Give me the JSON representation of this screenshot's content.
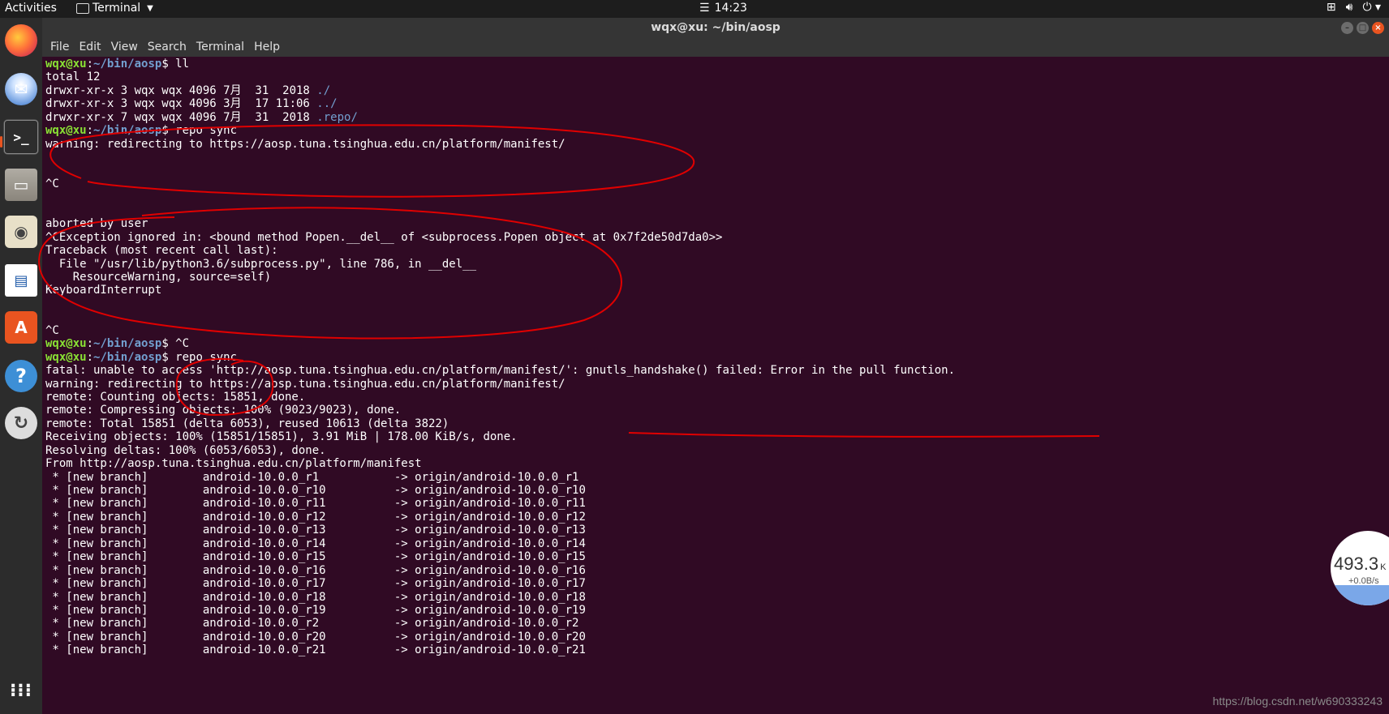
{
  "topbar": {
    "activities": "Activities",
    "app_name": "Terminal",
    "clock_icon": "list-icon",
    "clock": "14:23",
    "tray_icons": [
      "network-icon",
      "volume-icon",
      "power-icon"
    ]
  },
  "dock": {
    "items": [
      "firefox-icon",
      "thunderbird-icon",
      "terminal-icon",
      "files-icon",
      "rhythmbox-icon",
      "writer-icon",
      "software-center-icon",
      "help-icon",
      "software-updater-icon",
      "show-apps-icon"
    ]
  },
  "window": {
    "title": "wqx@xu: ~/bin/aosp",
    "menu": [
      "File",
      "Edit",
      "View",
      "Search",
      "Terminal",
      "Help"
    ]
  },
  "terminal": {
    "prompt_user": "wqx@xu",
    "prompt_path": "~/bin/aosp",
    "lines": [
      {
        "type": "prompt",
        "cmd": " ll"
      },
      {
        "type": "text",
        "text": "total 12"
      },
      {
        "type": "ls",
        "text": "drwxr-xr-x 3 wqx wqx 4096 7月  31  2018 ",
        "name": "./"
      },
      {
        "type": "ls",
        "text": "drwxr-xr-x 3 wqx wqx 4096 3月  17 11:06 ",
        "name": "../"
      },
      {
        "type": "ls",
        "text": "drwxr-xr-x 7 wqx wqx 4096 7月  31  2018 ",
        "name": ".repo/"
      },
      {
        "type": "prompt",
        "cmd": " repo sync"
      },
      {
        "type": "text",
        "text": "warning: redirecting to https://aosp.tuna.tsinghua.edu.cn/platform/manifest/"
      },
      {
        "type": "text",
        "text": ""
      },
      {
        "type": "text",
        "text": ""
      },
      {
        "type": "text",
        "text": "^C"
      },
      {
        "type": "text",
        "text": ""
      },
      {
        "type": "text",
        "text": ""
      },
      {
        "type": "text",
        "text": "aborted by user"
      },
      {
        "type": "text",
        "text": "^CException ignored in: <bound method Popen.__del__ of <subprocess.Popen object at 0x7f2de50d7da0>>"
      },
      {
        "type": "text",
        "text": "Traceback (most recent call last):"
      },
      {
        "type": "text",
        "text": "  File \"/usr/lib/python3.6/subprocess.py\", line 786, in __del__"
      },
      {
        "type": "text",
        "text": "    ResourceWarning, source=self)"
      },
      {
        "type": "text",
        "text": "KeyboardInterrupt"
      },
      {
        "type": "text",
        "text": ""
      },
      {
        "type": "text",
        "text": ""
      },
      {
        "type": "text",
        "text": "^C"
      },
      {
        "type": "prompt",
        "cmd": " ^C"
      },
      {
        "type": "prompt",
        "cmd": " repo sync"
      },
      {
        "type": "text",
        "text": "fatal: unable to access 'http://aosp.tuna.tsinghua.edu.cn/platform/manifest/': gnutls_handshake() failed: Error in the pull function."
      },
      {
        "type": "text",
        "text": "warning: redirecting to https://aosp.tuna.tsinghua.edu.cn/platform/manifest/"
      },
      {
        "type": "text",
        "text": "remote: Counting objects: 15851, done."
      },
      {
        "type": "text",
        "text": "remote: Compressing objects: 100% (9023/9023), done."
      },
      {
        "type": "text",
        "text": "remote: Total 15851 (delta 6053), reused 10613 (delta 3822)"
      },
      {
        "type": "text",
        "text": "Receiving objects: 100% (15851/15851), 3.91 MiB | 178.00 KiB/s, done."
      },
      {
        "type": "text",
        "text": "Resolving deltas: 100% (6053/6053), done."
      },
      {
        "type": "text",
        "text": "From http://aosp.tuna.tsinghua.edu.cn/platform/manifest"
      },
      {
        "type": "text",
        "text": " * [new branch]        android-10.0.0_r1           -> origin/android-10.0.0_r1"
      },
      {
        "type": "text",
        "text": " * [new branch]        android-10.0.0_r10          -> origin/android-10.0.0_r10"
      },
      {
        "type": "text",
        "text": " * [new branch]        android-10.0.0_r11          -> origin/android-10.0.0_r11"
      },
      {
        "type": "text",
        "text": " * [new branch]        android-10.0.0_r12          -> origin/android-10.0.0_r12"
      },
      {
        "type": "text",
        "text": " * [new branch]        android-10.0.0_r13          -> origin/android-10.0.0_r13"
      },
      {
        "type": "text",
        "text": " * [new branch]        android-10.0.0_r14          -> origin/android-10.0.0_r14"
      },
      {
        "type": "text",
        "text": " * [new branch]        android-10.0.0_r15          -> origin/android-10.0.0_r15"
      },
      {
        "type": "text",
        "text": " * [new branch]        android-10.0.0_r16          -> origin/android-10.0.0_r16"
      },
      {
        "type": "text",
        "text": " * [new branch]        android-10.0.0_r17          -> origin/android-10.0.0_r17"
      },
      {
        "type": "text",
        "text": " * [new branch]        android-10.0.0_r18          -> origin/android-10.0.0_r18"
      },
      {
        "type": "text",
        "text": " * [new branch]        android-10.0.0_r19          -> origin/android-10.0.0_r19"
      },
      {
        "type": "text",
        "text": " * [new branch]        android-10.0.0_r2           -> origin/android-10.0.0_r2"
      },
      {
        "type": "text",
        "text": " * [new branch]        android-10.0.0_r20          -> origin/android-10.0.0_r20"
      },
      {
        "type": "text",
        "text": " * [new branch]        android-10.0.0_r21          -> origin/android-10.0.0_r21"
      }
    ]
  },
  "net_widget": {
    "speed": "493.3",
    "unit": "K",
    "rate": "+0.0B/s"
  },
  "watermark": "https://blog.csdn.net/w690333243",
  "colors": {
    "terminal_bg": "#300a24",
    "prompt_user": "#8ae234",
    "prompt_path": "#729fcf",
    "annotation": "#e00000",
    "accent": "#e95420"
  }
}
